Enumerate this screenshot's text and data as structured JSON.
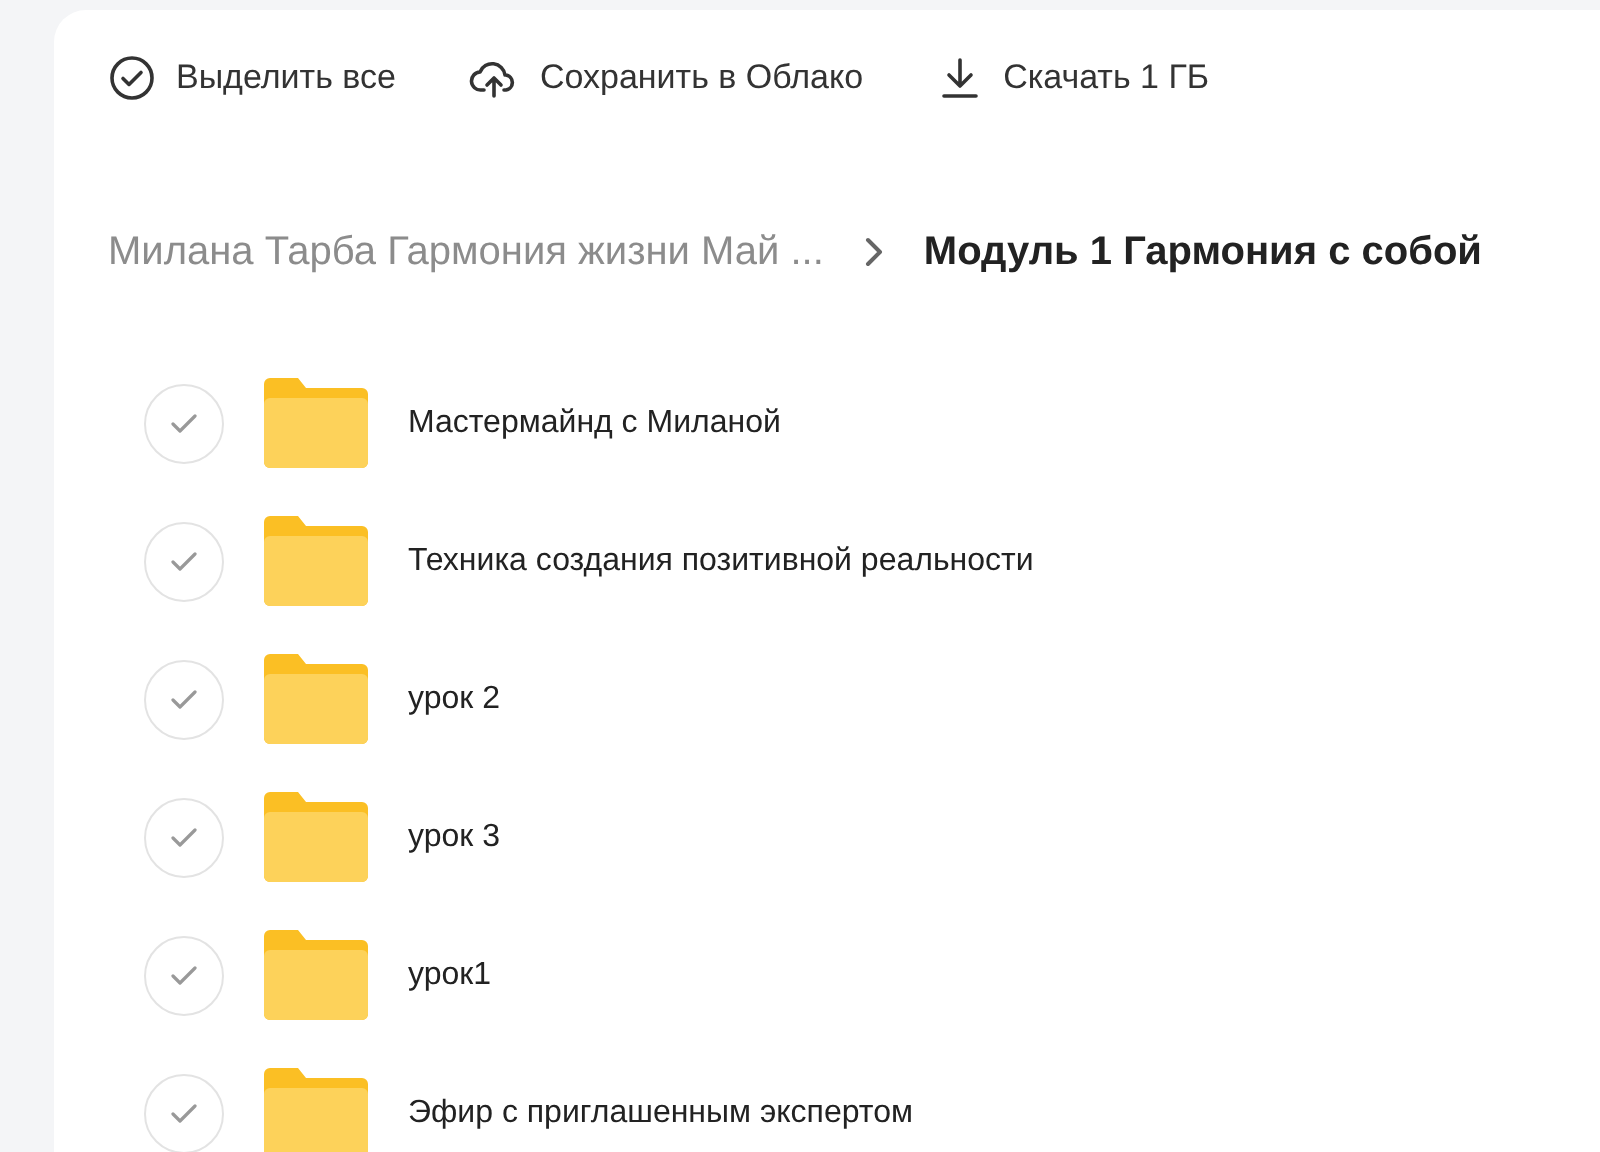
{
  "toolbar": [
    {
      "kind": "select",
      "label": "Выделить все"
    },
    {
      "kind": "cloud",
      "label": "Сохранить в Облако"
    },
    {
      "kind": "download",
      "label": "Скачать 1 ГБ"
    }
  ],
  "breadcrumbs": [
    {
      "label": "Милана Тарба Гармония жизни Май ...",
      "current": false
    },
    {
      "label": "Модуль 1 Гармония с собой",
      "current": true
    }
  ],
  "items": [
    {
      "name": "Мастермайнд с Миланой",
      "checked": false
    },
    {
      "name": "Техника создания позитивной реальности",
      "checked": false
    },
    {
      "name": "урок 2",
      "checked": false
    },
    {
      "name": "урок 3",
      "checked": false
    },
    {
      "name": "урок1",
      "checked": false
    },
    {
      "name": "Эфир с приглашенным экспертом",
      "checked": false
    }
  ]
}
